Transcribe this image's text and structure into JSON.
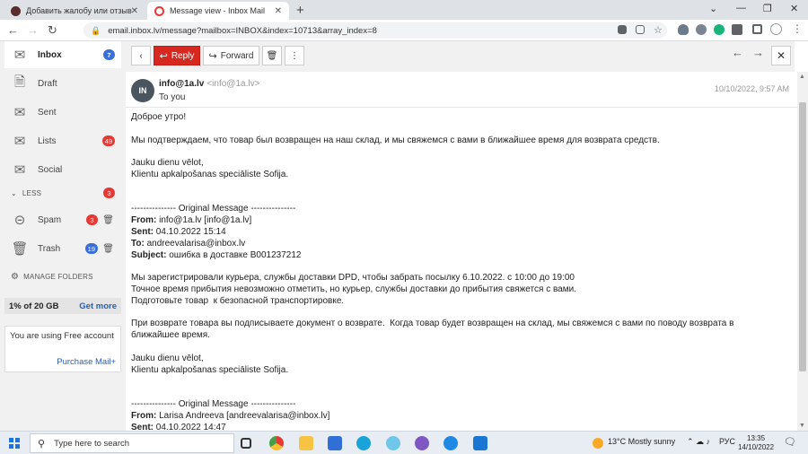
{
  "browser": {
    "tabs": [
      {
        "title": "Добавить жалобу или отзыв",
        "close": "✕"
      },
      {
        "title": "Message view - Inbox Mail",
        "close": "✕"
      }
    ],
    "new_tab": "+",
    "url": "email.inbox.lv/message?mailbox=INBOX&index=10713&array_index=8",
    "window_controls": {
      "minimize": "—",
      "maximize": "❐",
      "close": "✕",
      "tab_search": "⌄"
    }
  },
  "sidebar": {
    "items": [
      {
        "label": "Inbox",
        "badge": "7",
        "icon": "envelope-icon"
      },
      {
        "label": "Draft",
        "icon": "draft-icon"
      },
      {
        "label": "Sent",
        "icon": "sent-icon"
      },
      {
        "label": "Lists",
        "badge": "49",
        "icon": "lists-icon"
      },
      {
        "label": "Social",
        "icon": "social-icon"
      }
    ],
    "less": {
      "label": "LESS",
      "badge": "3"
    },
    "spam": {
      "label": "Spam",
      "badge": "3"
    },
    "trash": {
      "label": "Trash",
      "badge": "19"
    },
    "manage_folders": "MANAGE FOLDERS",
    "storage": {
      "used": "1% of 20 GB",
      "more": "Get more"
    },
    "free_box": {
      "text": "You are using Free account",
      "link": "Purchase Mail+"
    }
  },
  "toolbar": {
    "back": "‹",
    "reply": "Reply",
    "forward": "Forward",
    "delete": "🗑",
    "more": "⋮",
    "prev": "←",
    "next": "→",
    "close": "✕"
  },
  "message": {
    "avatar": "IN",
    "from_name": "info@1a.lv",
    "from_email": "<info@1a.lv>",
    "to": "To you",
    "date": "10/10/2022, 9:57 AM",
    "body": [
      "Доброе утро!",
      "",
      "Мы подтверждаем, что товар был возвращен на наш склад, и мы свяжемся с вами в ближайшее время для возврата средств.",
      "",
      "Jauku dienu vēlot,",
      "Klientu apkalpošanas speciāliste Sofija.",
      "",
      "",
      "--------------- Original Message ---------------"
    ],
    "quoted1": {
      "from_label": "From:",
      "from": " info@1a.lv [info@1a.lv]",
      "sent_label": "Sent:",
      "sent": " 04.10.2022 15:14",
      "to_label": "To:",
      "to": " andreevalarisa@inbox.lv",
      "subject_label": "Subject:",
      "subject": " ошибка в доставке B001237212"
    },
    "body2": [
      "",
      "Мы зарегистрировали курьера, службы доставки DPD, чтобы забрать посылку 6.10.2022. с 10:00 до 19:00",
      "Точное время прибытия невозможно отметить, но курьер, службы доставки до прибытия свяжется с вами.",
      "Подготовьте товар  к безопасной транспортировке.",
      "",
      "При возврате товара вы подписываете документ о возврате.  Когда товар будет возвращен на склад, мы свяжемся с вами по поводу возврата в",
      "ближайшее время.",
      "",
      "Jauku dienu vēlot,",
      "Klientu apkalpošanas speciāliste Sofija.",
      "",
      "",
      "--------------- Original Message ---------------"
    ],
    "quoted2": {
      "from_label": "From:",
      "from": " Larisa Andreeva [andreevalarisa@inbox.lv]",
      "sent_label": "Sent:",
      "sent": " 04.10.2022 14:47"
    }
  },
  "taskbar": {
    "search_placeholder": "Type here to search",
    "weather": "13°C  Mostly sunny",
    "lang": "РУС",
    "time": "13:35",
    "date": "14/10/2022"
  }
}
